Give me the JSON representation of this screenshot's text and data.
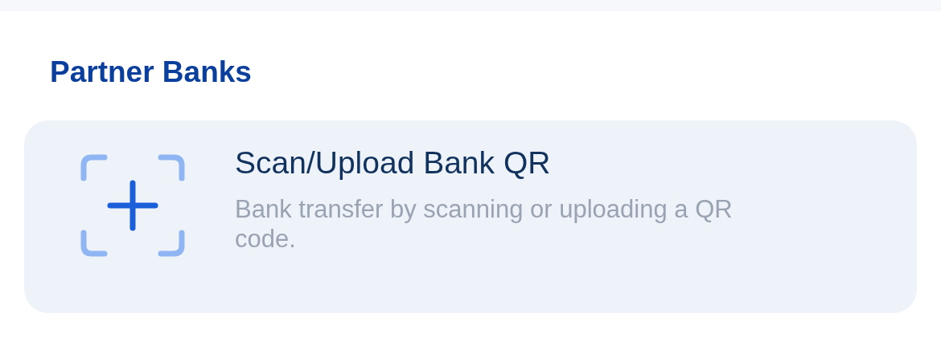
{
  "section": {
    "title": "Partner Banks"
  },
  "card": {
    "title": "Scan/Upload Bank QR",
    "description": "Bank transfer by scanning or uploading a QR code."
  }
}
